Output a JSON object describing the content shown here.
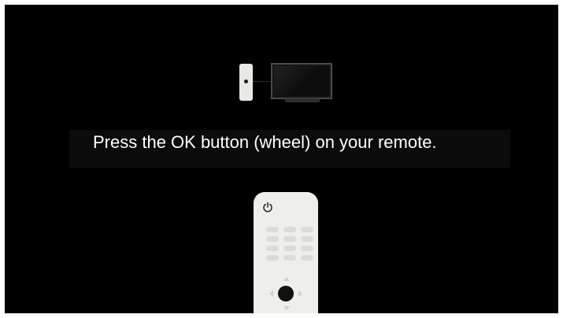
{
  "instruction": {
    "text": "Press the OK button (wheel) on your remote."
  },
  "illustration": {
    "top_devices": [
      "set-top-box-icon",
      "tv-icon"
    ],
    "remote_icons": [
      "power-icon",
      "ok-button-icon"
    ]
  },
  "colors": {
    "background": "#000000",
    "text": "#ffffff",
    "device_body": "#eeeeea",
    "ok_button": "#111111"
  }
}
